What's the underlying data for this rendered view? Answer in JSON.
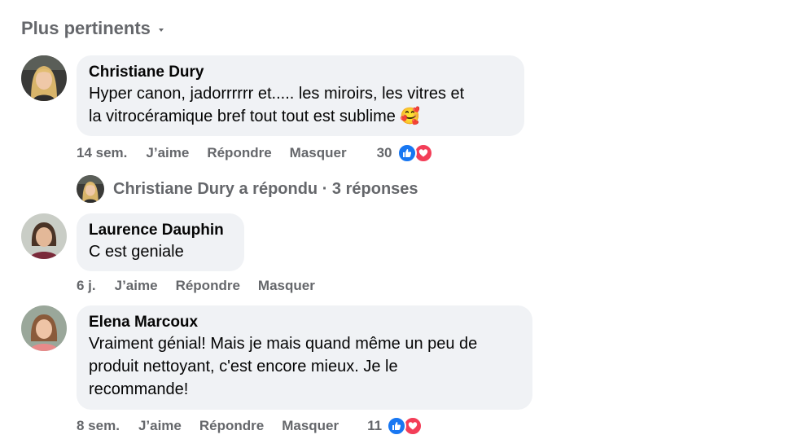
{
  "sort": {
    "label": "Plus pertinents",
    "icon": "caret-down-icon"
  },
  "comments": [
    {
      "author": "Christiane Dury",
      "text_lines": [
        "Hyper canon, jadorrrrrr et..... les miroirs, les vitres et",
        "la vitrocéramique bref tout tout est sublime 🥰"
      ],
      "time": "14 sem.",
      "like_label": "J’aime",
      "reply_label": "Répondre",
      "hide_label": "Masquer",
      "reaction_count": "30",
      "reactions": [
        "like-icon",
        "love-icon"
      ]
    },
    {
      "author": "Laurence Dauphin",
      "text_lines": [
        "C est geniale"
      ],
      "time": "6 j.",
      "like_label": "J’aime",
      "reply_label": "Répondre",
      "hide_label": "Masquer"
    },
    {
      "author": "Elena Marcoux",
      "text_lines": [
        "Vraiment génial! Mais je mais quand même un peu de",
        "produit nettoyant, c'est encore mieux. Je le",
        "recommande!"
      ],
      "time": "8 sem.",
      "like_label": "J’aime",
      "reply_label": "Répondre",
      "hide_label": "Masquer",
      "reaction_count": "11",
      "reactions": [
        "like-icon",
        "love-icon"
      ]
    }
  ],
  "replies_summary": {
    "text": "Christiane Dury a répondu · 3 réponses"
  },
  "colors": {
    "bubble": "#f0f2f5",
    "secondary_text": "#65676b",
    "like_blue": "#1877f2",
    "love_red": "#f33e58"
  }
}
